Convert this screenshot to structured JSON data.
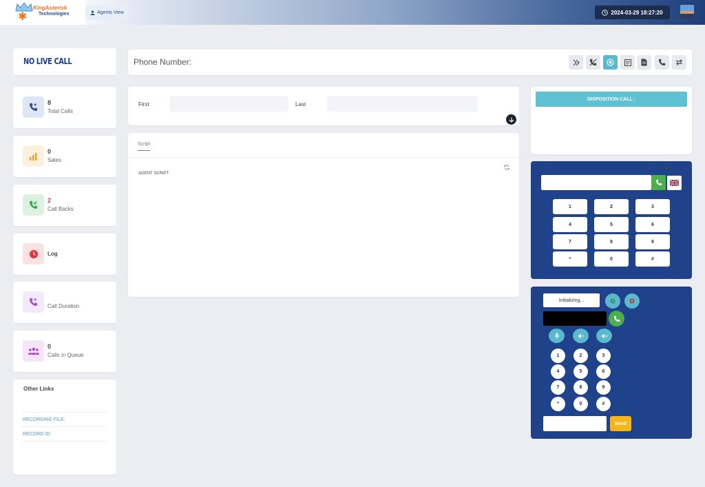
{
  "header": {
    "logo_text": "KingAsterisk",
    "logo_sub": "Technologies",
    "agents_view_label": "Agents View",
    "datetime": "2024-03-29 18:27:20"
  },
  "status": {
    "no_live_call": "NO LIVE CALL"
  },
  "stats": [
    {
      "value": "8",
      "label": "Total Calls",
      "icon": "phone-plus-icon",
      "color": "#2d4f8b"
    },
    {
      "value": "0",
      "label": "Sales",
      "icon": "bar-chart-icon",
      "color": "#f0a030"
    },
    {
      "value": "2",
      "label": "Call Backs",
      "icon": "phone-incoming-icon",
      "color": "#3aa54a",
      "value_color": "#e03b3b"
    },
    {
      "value": "",
      "label": "Log",
      "icon": "clock-icon",
      "color": "#e0353b"
    },
    {
      "value": "",
      "label": "Call Duration",
      "icon": "phone-plus-icon",
      "color": "#9b4fd6"
    },
    {
      "value": "0",
      "label": "Calls in Queue",
      "icon": "users-icon",
      "color": "#b043c7"
    }
  ],
  "other_links": {
    "title": "Other Links",
    "recording_file": "RECORDING FILE:",
    "record_id": "RECORD ID:"
  },
  "phone_bar": {
    "label": "Phone Number:"
  },
  "names": {
    "first_label": "First",
    "last_label": "Last"
  },
  "script": {
    "tab_label": "Script",
    "content": "AGENT SCRIPT"
  },
  "disposition": {
    "button_label": "DISPOSITION CALL :"
  },
  "dialpad": {
    "keys": [
      "1",
      "2",
      "3",
      "4",
      "5",
      "6",
      "7",
      "8",
      "9",
      "*",
      "0",
      "#"
    ]
  },
  "softphone": {
    "status": "Initializing...",
    "keys": [
      "1",
      "2",
      "3",
      "4",
      "5",
      "6",
      "7",
      "8",
      "9",
      "*",
      "0",
      "#"
    ],
    "send_label": "Send"
  }
}
